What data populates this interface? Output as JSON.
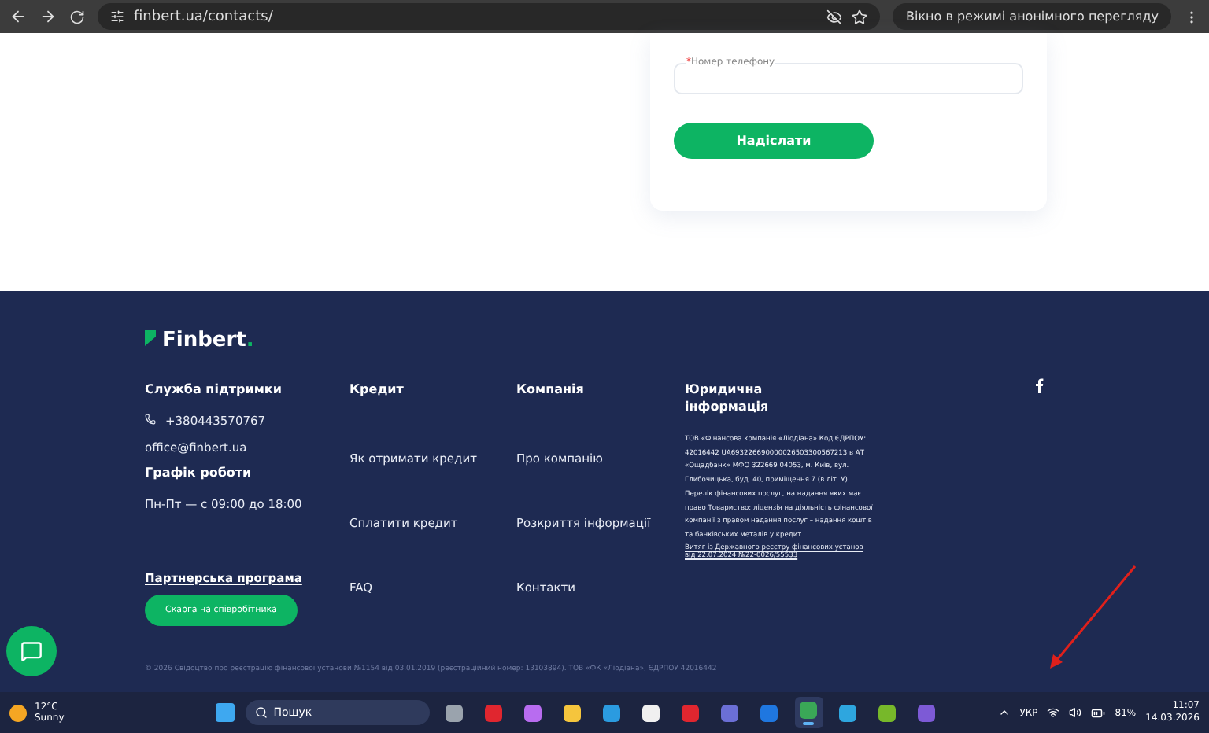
{
  "browser": {
    "url": "finbert.ua/contacts/",
    "incognito": "Вікно в режимі анонімного перегляду"
  },
  "form": {
    "phone_label": "Номер телефону",
    "required_mark": "*",
    "submit": "Надіслати"
  },
  "footer": {
    "logo": "Finbert",
    "logo_dot": ".",
    "support": {
      "title": "Служба підтримки",
      "phone": "+380443570767",
      "email": "office@finbert.ua",
      "hours_title": "Графік роботи",
      "hours": "Пн-Пт — с 09:00 до 18:00",
      "partner": "Партнерська програма",
      "complaint": "Скарга на співробітника"
    },
    "columns": [
      {
        "title": "Кредит",
        "links": [
          "Як отримати кредит",
          "Сплатити кредит",
          "FAQ"
        ]
      },
      {
        "title": "Компанія",
        "links": [
          "Про компанію",
          "Розкриття інформації",
          "Контакти"
        ]
      }
    ],
    "legal": {
      "title": "Юридична інформація",
      "text": "ТОВ «Фінансова компанія «Ліодіана» Код ЄДРПОУ: 42016442 UA693226690000026503300567213 в АТ «Ощадбанк» МФО 322669 04053, м. Київ, вул. Глибочицька, буд. 40, приміщення 7 (в літ. У) Перелік фінансових послуг, на надання яких має право Товариство: ліцензія на діяльність фінансової компанії з правом надання послуг – надання коштів та банківських металів у кредит",
      "link": "Витяг із Державного реєстру фінансових установ від 22.07.2024 №22-0026/55533"
    },
    "copyright": "© 2026 Свідоцтво про реєстрацію фінансової установи №1154 від 03.01.2019 (реєстраційний номер: 13103894). ТОВ «ФК «Ліодіана», ЄДРПОУ 42016442"
  },
  "taskbar": {
    "weather_temp": "12°C",
    "weather_text": "Sunny",
    "search": "Пошук",
    "lang": "УКР",
    "battery": "81%",
    "time": "11:07",
    "date": "14.03.2026",
    "apps": [
      {
        "color": "#9aa3ad",
        "selected": false
      },
      {
        "color": "#e0262f",
        "selected": false
      },
      {
        "color": "#b86cf0",
        "selected": false
      },
      {
        "color": "#f5c53d",
        "selected": false
      },
      {
        "color": "#2b9be0",
        "selected": false
      },
      {
        "color": "#f0f0f0",
        "selected": false
      },
      {
        "color": "#e0262f",
        "selected": false
      },
      {
        "color": "#6b6fd6",
        "selected": false
      },
      {
        "color": "#1f77e0",
        "selected": false
      },
      {
        "color": "#3aa757",
        "selected": true
      },
      {
        "color": "#2ea6df",
        "selected": false
      },
      {
        "color": "#77b82a",
        "selected": false
      },
      {
        "color": "#7d5ad6",
        "selected": false
      }
    ]
  }
}
